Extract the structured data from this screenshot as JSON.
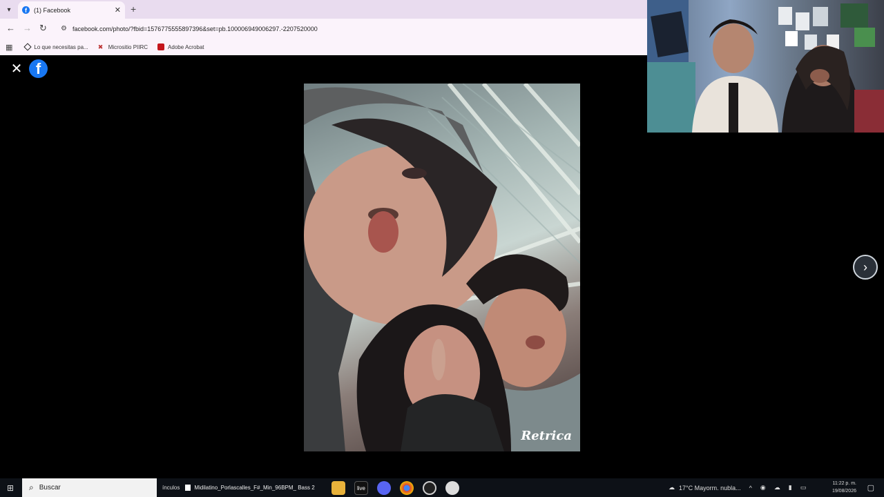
{
  "browser": {
    "tab_title": "(1) Facebook",
    "url": "facebook.com/photo/?fbid=1576775555897396&set=pb.100006949006297.-2207520000",
    "bookmarks": [
      "Lo que necesitas pa...",
      "Micrositio PIIRC",
      "Adobe Acrobat"
    ]
  },
  "photo": {
    "watermark": "Retrica"
  },
  "taskbar": {
    "search_placeholder": "Buscar",
    "partial_text": "ínculos",
    "app_label": "Midilatino_Porlascalles_F#_Min_96BPM_ Bass 2",
    "pinned": [
      "file-explorer-icon",
      "live-icon",
      "discord-icon",
      "chrome-icon",
      "recorder-icon",
      "obs-icon"
    ],
    "weather": "17°C  Mayorm. nubla...",
    "time": "11:22 p. m.",
    "date": "19/08/2026"
  },
  "colors": {
    "facebook_blue": "#1877f2",
    "viewer_bg": "#000000"
  }
}
